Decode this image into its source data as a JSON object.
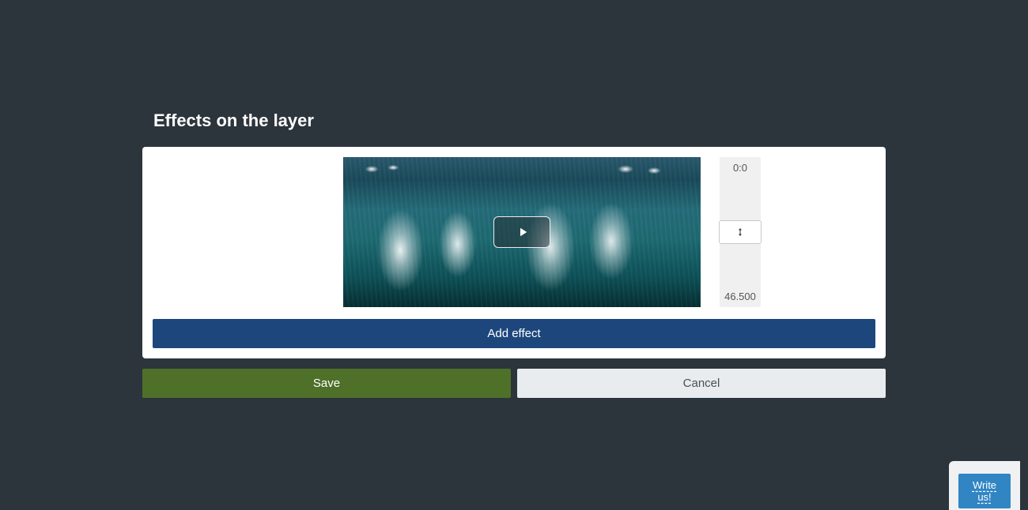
{
  "title": "Effects on the layer",
  "timeline": {
    "start": "0:0",
    "end": "46.500"
  },
  "buttons": {
    "add_effect": "Add effect",
    "save": "Save",
    "cancel": "Cancel",
    "write_us": "Write us!"
  }
}
